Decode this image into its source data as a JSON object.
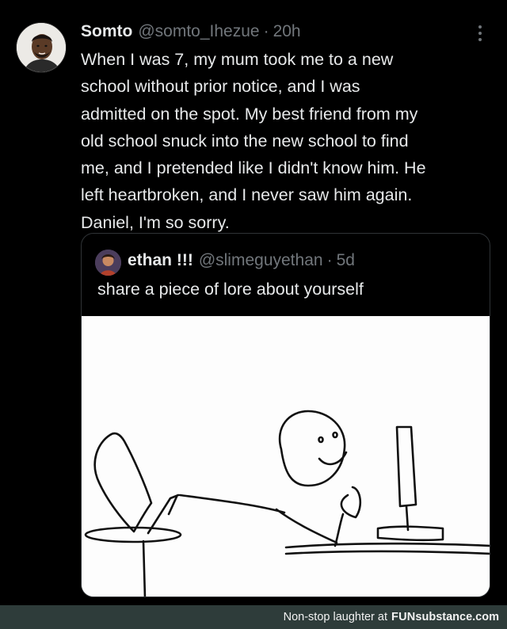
{
  "tweet": {
    "display_name": "Somto",
    "handle": "@somto_Ihezue",
    "separator": "·",
    "time": "20h",
    "text": "When I was 7, my mum took me to a new\nschool without prior notice, and I was\nadmitted on the spot. My best friend from my\nold school snuck into the new school to find\nme, and I pretended like I didn't know him. He\nleft heartbroken, and I never saw him again.\nDaniel, I'm so sorry.",
    "more_icon": "more-vertical-icon"
  },
  "quote": {
    "display_name": "ethan !!!",
    "handle": "@slimeguyethan",
    "separator": "·",
    "time": "5d",
    "text": "share a piece of lore about yourself"
  },
  "footer": {
    "prefix": "Non-stop laughter at",
    "brand_bold": "FUN",
    "brand_rest": "substance.com"
  },
  "colors": {
    "background": "#000000",
    "text": "#e7e9ea",
    "muted": "#71767b",
    "border": "#2f3336",
    "footer_bg": "#2e3c3a"
  }
}
